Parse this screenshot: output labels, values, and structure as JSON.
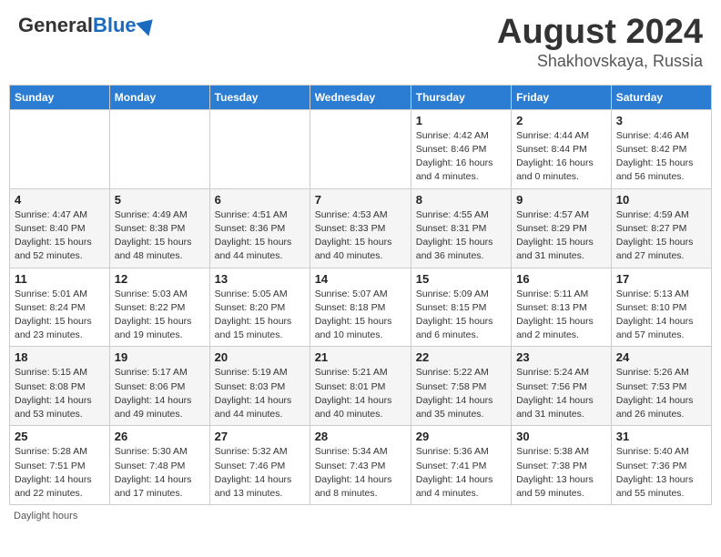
{
  "logo": {
    "general": "General",
    "blue": "Blue"
  },
  "title": {
    "month_year": "August 2024",
    "location": "Shakhovskaya, Russia"
  },
  "days_of_week": [
    "Sunday",
    "Monday",
    "Tuesday",
    "Wednesday",
    "Thursday",
    "Friday",
    "Saturday"
  ],
  "footer": {
    "daylight_hours": "Daylight hours"
  },
  "weeks": [
    [
      {
        "day": "",
        "info": ""
      },
      {
        "day": "",
        "info": ""
      },
      {
        "day": "",
        "info": ""
      },
      {
        "day": "",
        "info": ""
      },
      {
        "day": "1",
        "info": "Sunrise: 4:42 AM\nSunset: 8:46 PM\nDaylight: 16 hours\nand 4 minutes."
      },
      {
        "day": "2",
        "info": "Sunrise: 4:44 AM\nSunset: 8:44 PM\nDaylight: 16 hours\nand 0 minutes."
      },
      {
        "day": "3",
        "info": "Sunrise: 4:46 AM\nSunset: 8:42 PM\nDaylight: 15 hours\nand 56 minutes."
      }
    ],
    [
      {
        "day": "4",
        "info": "Sunrise: 4:47 AM\nSunset: 8:40 PM\nDaylight: 15 hours\nand 52 minutes."
      },
      {
        "day": "5",
        "info": "Sunrise: 4:49 AM\nSunset: 8:38 PM\nDaylight: 15 hours\nand 48 minutes."
      },
      {
        "day": "6",
        "info": "Sunrise: 4:51 AM\nSunset: 8:36 PM\nDaylight: 15 hours\nand 44 minutes."
      },
      {
        "day": "7",
        "info": "Sunrise: 4:53 AM\nSunset: 8:33 PM\nDaylight: 15 hours\nand 40 minutes."
      },
      {
        "day": "8",
        "info": "Sunrise: 4:55 AM\nSunset: 8:31 PM\nDaylight: 15 hours\nand 36 minutes."
      },
      {
        "day": "9",
        "info": "Sunrise: 4:57 AM\nSunset: 8:29 PM\nDaylight: 15 hours\nand 31 minutes."
      },
      {
        "day": "10",
        "info": "Sunrise: 4:59 AM\nSunset: 8:27 PM\nDaylight: 15 hours\nand 27 minutes."
      }
    ],
    [
      {
        "day": "11",
        "info": "Sunrise: 5:01 AM\nSunset: 8:24 PM\nDaylight: 15 hours\nand 23 minutes."
      },
      {
        "day": "12",
        "info": "Sunrise: 5:03 AM\nSunset: 8:22 PM\nDaylight: 15 hours\nand 19 minutes."
      },
      {
        "day": "13",
        "info": "Sunrise: 5:05 AM\nSunset: 8:20 PM\nDaylight: 15 hours\nand 15 minutes."
      },
      {
        "day": "14",
        "info": "Sunrise: 5:07 AM\nSunset: 8:18 PM\nDaylight: 15 hours\nand 10 minutes."
      },
      {
        "day": "15",
        "info": "Sunrise: 5:09 AM\nSunset: 8:15 PM\nDaylight: 15 hours\nand 6 minutes."
      },
      {
        "day": "16",
        "info": "Sunrise: 5:11 AM\nSunset: 8:13 PM\nDaylight: 15 hours\nand 2 minutes."
      },
      {
        "day": "17",
        "info": "Sunrise: 5:13 AM\nSunset: 8:10 PM\nDaylight: 14 hours\nand 57 minutes."
      }
    ],
    [
      {
        "day": "18",
        "info": "Sunrise: 5:15 AM\nSunset: 8:08 PM\nDaylight: 14 hours\nand 53 minutes."
      },
      {
        "day": "19",
        "info": "Sunrise: 5:17 AM\nSunset: 8:06 PM\nDaylight: 14 hours\nand 49 minutes."
      },
      {
        "day": "20",
        "info": "Sunrise: 5:19 AM\nSunset: 8:03 PM\nDaylight: 14 hours\nand 44 minutes."
      },
      {
        "day": "21",
        "info": "Sunrise: 5:21 AM\nSunset: 8:01 PM\nDaylight: 14 hours\nand 40 minutes."
      },
      {
        "day": "22",
        "info": "Sunrise: 5:22 AM\nSunset: 7:58 PM\nDaylight: 14 hours\nand 35 minutes."
      },
      {
        "day": "23",
        "info": "Sunrise: 5:24 AM\nSunset: 7:56 PM\nDaylight: 14 hours\nand 31 minutes."
      },
      {
        "day": "24",
        "info": "Sunrise: 5:26 AM\nSunset: 7:53 PM\nDaylight: 14 hours\nand 26 minutes."
      }
    ],
    [
      {
        "day": "25",
        "info": "Sunrise: 5:28 AM\nSunset: 7:51 PM\nDaylight: 14 hours\nand 22 minutes."
      },
      {
        "day": "26",
        "info": "Sunrise: 5:30 AM\nSunset: 7:48 PM\nDaylight: 14 hours\nand 17 minutes."
      },
      {
        "day": "27",
        "info": "Sunrise: 5:32 AM\nSunset: 7:46 PM\nDaylight: 14 hours\nand 13 minutes."
      },
      {
        "day": "28",
        "info": "Sunrise: 5:34 AM\nSunset: 7:43 PM\nDaylight: 14 hours\nand 8 minutes."
      },
      {
        "day": "29",
        "info": "Sunrise: 5:36 AM\nSunset: 7:41 PM\nDaylight: 14 hours\nand 4 minutes."
      },
      {
        "day": "30",
        "info": "Sunrise: 5:38 AM\nSunset: 7:38 PM\nDaylight: 13 hours\nand 59 minutes."
      },
      {
        "day": "31",
        "info": "Sunrise: 5:40 AM\nSunset: 7:36 PM\nDaylight: 13 hours\nand 55 minutes."
      }
    ]
  ]
}
